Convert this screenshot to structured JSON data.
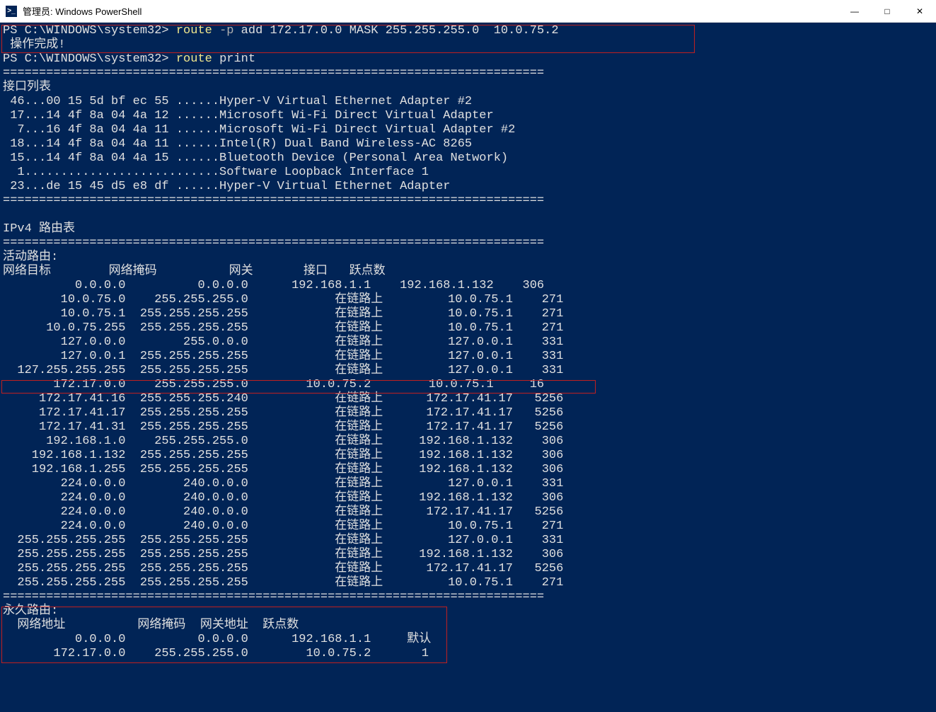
{
  "window": {
    "title": "管理员: Windows PowerShell",
    "icon_text": ">_"
  },
  "ps": {
    "prompt": "PS C:\\WINDOWS\\system32>",
    "cmd1_route": "route",
    "cmd1_flag": "-p",
    "cmd1_rest": "add 172.17.0.0 MASK 255.255.255.0  10.0.75.2",
    "done": " 操作完成!",
    "cmd2_route": "route",
    "cmd2_rest": "print"
  },
  "sep": "===========================================================================",
  "if_header": "接口列表",
  "interfaces": [
    " 46...00 15 5d bf ec 55 ......Hyper-V Virtual Ethernet Adapter #2",
    " 17...14 4f 8a 04 4a 12 ......Microsoft Wi-Fi Direct Virtual Adapter",
    "  7...16 4f 8a 04 4a 11 ......Microsoft Wi-Fi Direct Virtual Adapter #2",
    " 18...14 4f 8a 04 4a 11 ......Intel(R) Dual Band Wireless-AC 8265",
    " 15...14 4f 8a 04 4a 15 ......Bluetooth Device (Personal Area Network)",
    "  1...........................Software Loopback Interface 1",
    " 23...de 15 45 d5 e8 df ......Hyper-V Virtual Ethernet Adapter"
  ],
  "ipv4_title": "IPv4 路由表",
  "active_routes_label": "活动路由:",
  "route_header": "网络目标        网络掩码          网关       接口   跃点数",
  "routes": [
    "          0.0.0.0          0.0.0.0      192.168.1.1    192.168.1.132    306",
    "        10.0.75.0    255.255.255.0            在链路上         10.0.75.1    271",
    "        10.0.75.1  255.255.255.255            在链路上         10.0.75.1    271",
    "      10.0.75.255  255.255.255.255            在链路上         10.0.75.1    271",
    "        127.0.0.0        255.0.0.0            在链路上         127.0.0.1    331",
    "        127.0.0.1  255.255.255.255            在链路上         127.0.0.1    331",
    "  127.255.255.255  255.255.255.255            在链路上         127.0.0.1    331",
    "       172.17.0.0    255.255.255.0        10.0.75.2        10.0.75.1     16",
    "     172.17.41.16  255.255.255.240            在链路上      172.17.41.17   5256",
    "     172.17.41.17  255.255.255.255            在链路上      172.17.41.17   5256",
    "     172.17.41.31  255.255.255.255            在链路上      172.17.41.17   5256",
    "      192.168.1.0    255.255.255.0            在链路上     192.168.1.132    306",
    "    192.168.1.132  255.255.255.255            在链路上     192.168.1.132    306",
    "    192.168.1.255  255.255.255.255            在链路上     192.168.1.132    306",
    "        224.0.0.0        240.0.0.0            在链路上         127.0.0.1    331",
    "        224.0.0.0        240.0.0.0            在链路上     192.168.1.132    306",
    "        224.0.0.0        240.0.0.0            在链路上      172.17.41.17   5256",
    "        224.0.0.0        240.0.0.0            在链路上         10.0.75.1    271",
    "  255.255.255.255  255.255.255.255            在链路上         127.0.0.1    331",
    "  255.255.255.255  255.255.255.255            在链路上     192.168.1.132    306",
    "  255.255.255.255  255.255.255.255            在链路上      172.17.41.17   5256",
    "  255.255.255.255  255.255.255.255            在链路上         10.0.75.1    271"
  ],
  "persistent_label": "永久路由:",
  "persistent_header": "  网络地址          网络掩码  网关地址  跃点数",
  "persistent_routes": [
    "          0.0.0.0          0.0.0.0      192.168.1.1     默认",
    "       172.17.0.0    255.255.255.0        10.0.75.2       1"
  ],
  "colors": {
    "bg": "#012456",
    "fg": "#e0e0e0",
    "yellow": "#f0e68c",
    "gray": "#b0b0b0",
    "highlight": "#c02020"
  }
}
